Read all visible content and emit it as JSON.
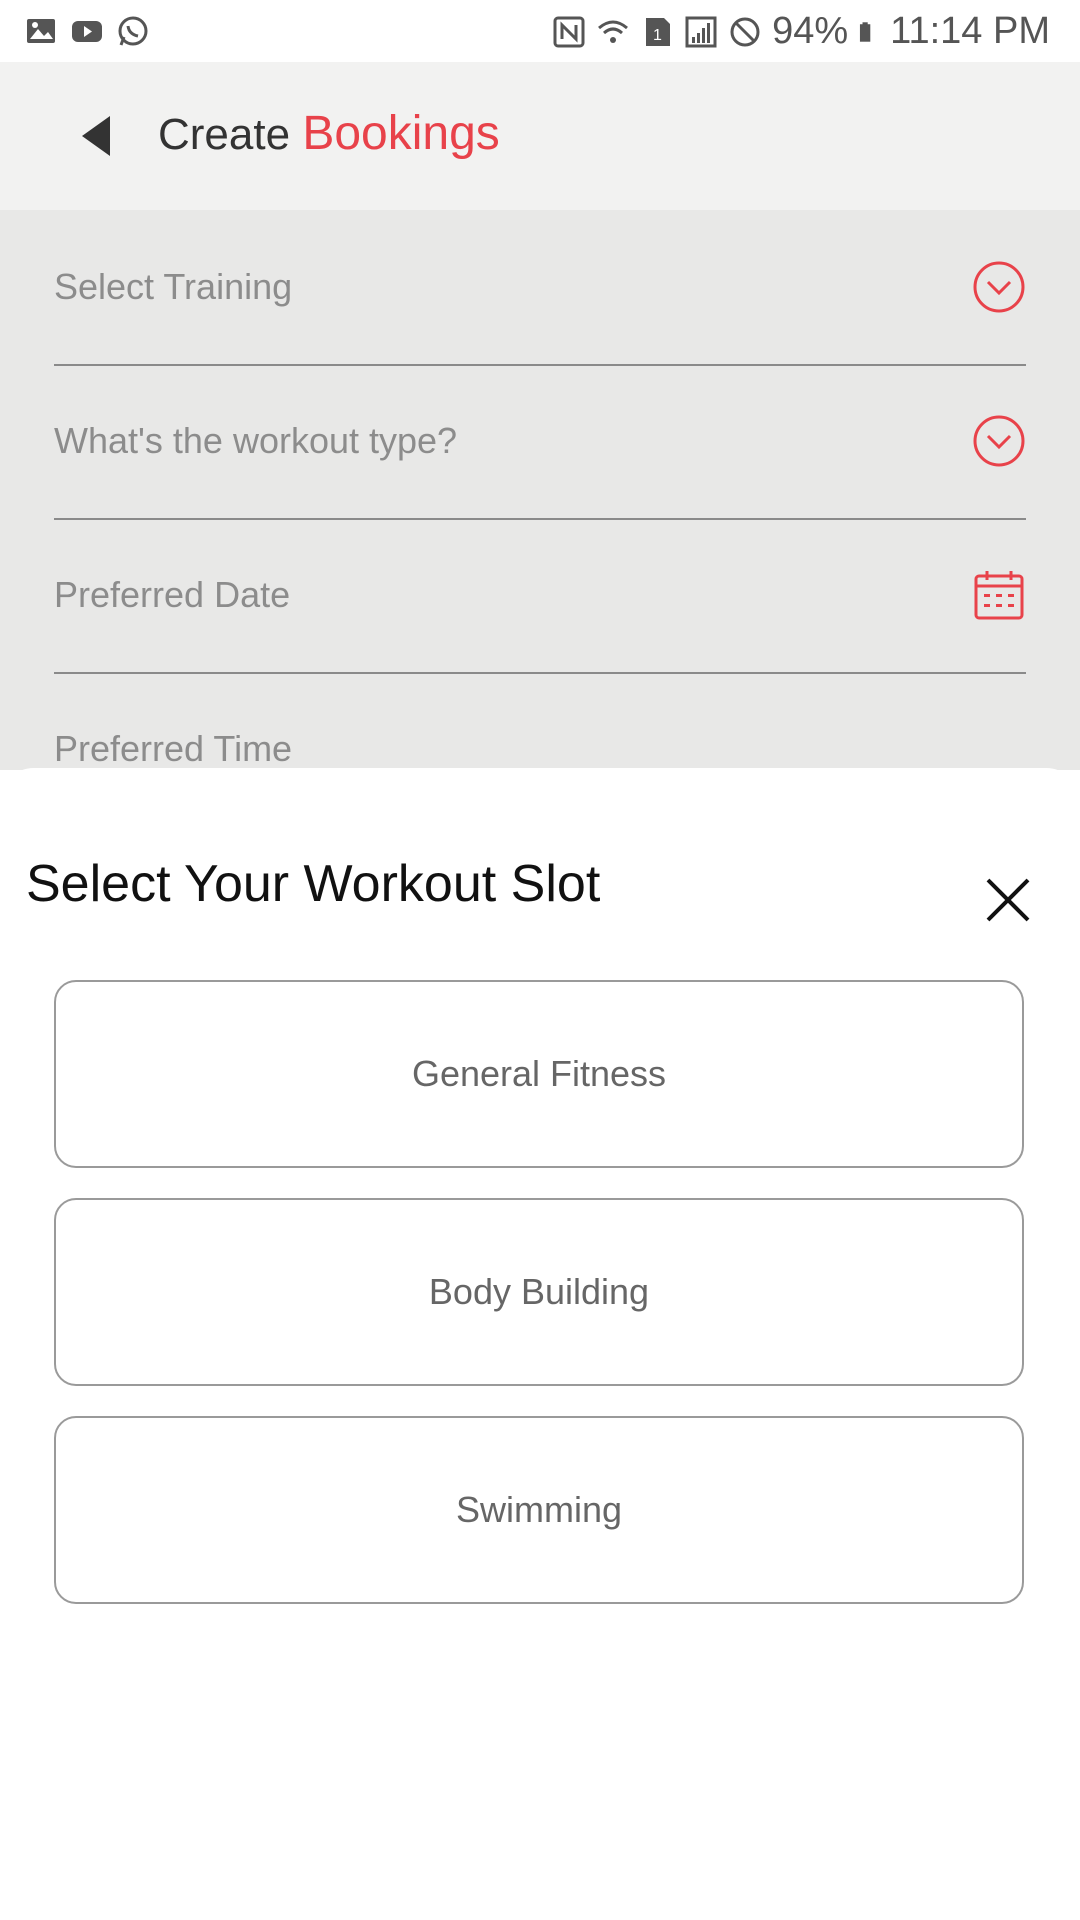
{
  "status_bar": {
    "left_icons": [
      "gallery-icon",
      "youtube-icon",
      "whatsapp-icon"
    ],
    "right_icons": [
      "nfc-icon",
      "wifi-icon",
      "sim-1-icon",
      "signal-icon",
      "do-not-disturb-icon",
      "battery-icon"
    ],
    "battery": "94%",
    "time": "11:14 PM"
  },
  "header": {
    "title_prefix": "Create",
    "title_accent": "Bookings",
    "back_icon": "back-arrow-icon"
  },
  "form": {
    "fields": [
      {
        "label": "Select Training",
        "icon": "chevron-down-circle-icon"
      },
      {
        "label": "What's the workout type?",
        "icon": "chevron-down-circle-icon"
      },
      {
        "label": "Preferred Date",
        "icon": "calendar-icon"
      },
      {
        "label": "Preferred Time",
        "icon": ""
      }
    ]
  },
  "sheet": {
    "title": "Select Your Workout Slot",
    "close_icon": "close-icon",
    "options": [
      {
        "label": "General Fitness"
      },
      {
        "label": "Body Building"
      },
      {
        "label": "Swimming"
      }
    ]
  },
  "colors": {
    "accent": "#e8424a",
    "header_bg": "#f2f2f1",
    "form_bg": "#e8e8e7"
  }
}
